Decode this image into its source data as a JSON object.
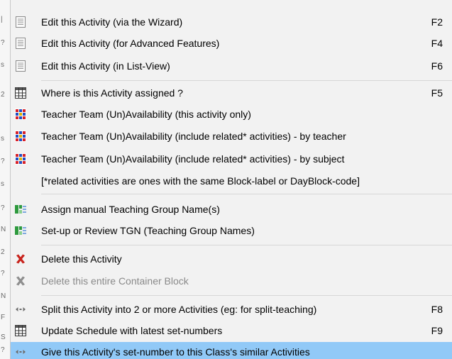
{
  "background_window": {
    "edge_glyphs": [
      "|",
      "?",
      "s",
      "2",
      "s",
      "?",
      "s",
      "?",
      "N",
      "2",
      "?",
      "N",
      "F",
      "S",
      "?",
      "?"
    ]
  },
  "menu": {
    "edit_wizard": {
      "label": "Edit this Activity (via the Wizard)",
      "shortcut": "F2",
      "icon": "document-lines-icon"
    },
    "edit_advanced": {
      "label": "Edit this Activity (for Advanced Features)",
      "shortcut": "F4",
      "icon": "document-lines-icon"
    },
    "edit_listview": {
      "label": "Edit this Activity (in List-View)",
      "shortcut": "F6",
      "icon": "document-lines-icon"
    },
    "where_assigned": {
      "label": "Where is this Activity assigned ?",
      "shortcut": "F5",
      "icon": "grid-table-icon"
    },
    "team_this_only": {
      "label": "Teacher Team (Un)Availability (this activity only)",
      "icon": "teacher-team-icon"
    },
    "team_by_teacher": {
      "label": "Teacher Team (Un)Availability (include related* activities) - by teacher",
      "icon": "teacher-team-icon"
    },
    "team_by_subject": {
      "label": "Teacher Team (Un)Availability (include related* activities) - by subject",
      "icon": "teacher-team-icon"
    },
    "related_note": {
      "label": "[*related activities are ones with the same Block-label or DayBlock-code]"
    },
    "assign_tgn": {
      "label": "Assign manual Teaching Group Name(s)",
      "icon": "teaching-group-icon"
    },
    "setup_tgn": {
      "label": "Set-up or Review TGN (Teaching Group Names)",
      "icon": "teaching-group-icon"
    },
    "delete_activity": {
      "label": "Delete this Activity",
      "icon": "red-x-icon"
    },
    "delete_container": {
      "label": "Delete this entire Container Block",
      "icon": "grey-x-icon",
      "disabled": true
    },
    "split_activity": {
      "label": "Split this Activity into 2 or more Activities (eg: for split-teaching)",
      "shortcut": "F8",
      "icon": "split-arrows-icon"
    },
    "update_schedule": {
      "label": "Update Schedule with latest set-numbers",
      "shortcut": "F9",
      "icon": "grid-table-icon"
    },
    "give_setnumber": {
      "label": "Give this Activity's set-number to this Class's similar Activities",
      "icon": "split-arrows-icon",
      "highlighted": true
    }
  },
  "colors": {
    "menu_bg": "#f2f2f2",
    "highlight": "#91c9f7",
    "delete_red": "#c8231c",
    "disabled_text": "#8a8a8a",
    "separator": "#d7d7d7"
  }
}
